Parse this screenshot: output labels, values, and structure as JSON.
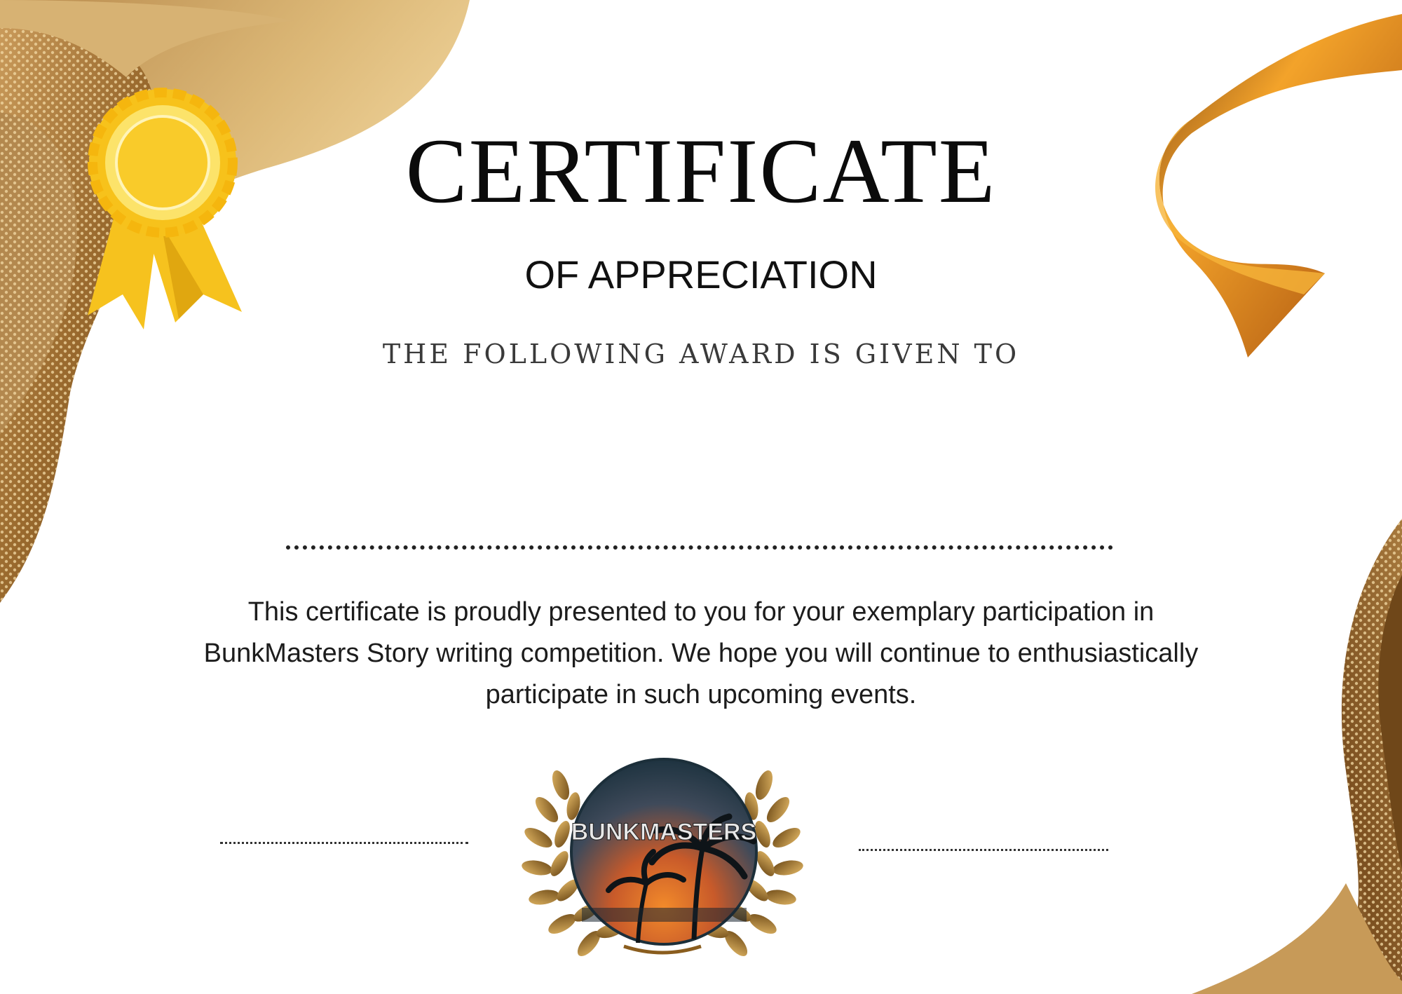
{
  "certificate": {
    "title": "CERTIFICATE",
    "subtitle": "OF APPRECIATION",
    "given_to_label": "THE FOLLOWING AWARD IS GIVEN TO",
    "recipient_name": "",
    "body_line_1": "This certificate is proudly presented to you for your exemplary participation in",
    "body_line_2": "BunkMasters Story writing competition. We hope you will continue to enthusiastically",
    "body_line_3": "participate in such upcoming events."
  },
  "seal": {
    "logo_text": "BUNKMASTERS",
    "icon": "laurel-wreath-icon"
  },
  "decorations": {
    "medal_icon": "rosette-medal-icon",
    "ribbon_icon": "ribbon-icon"
  },
  "colors": {
    "gold_light": "#d9b77a",
    "gold_dark": "#8a5a22",
    "medal_yellow": "#f7c21b",
    "ribbon_orange": "#f2a52a"
  }
}
